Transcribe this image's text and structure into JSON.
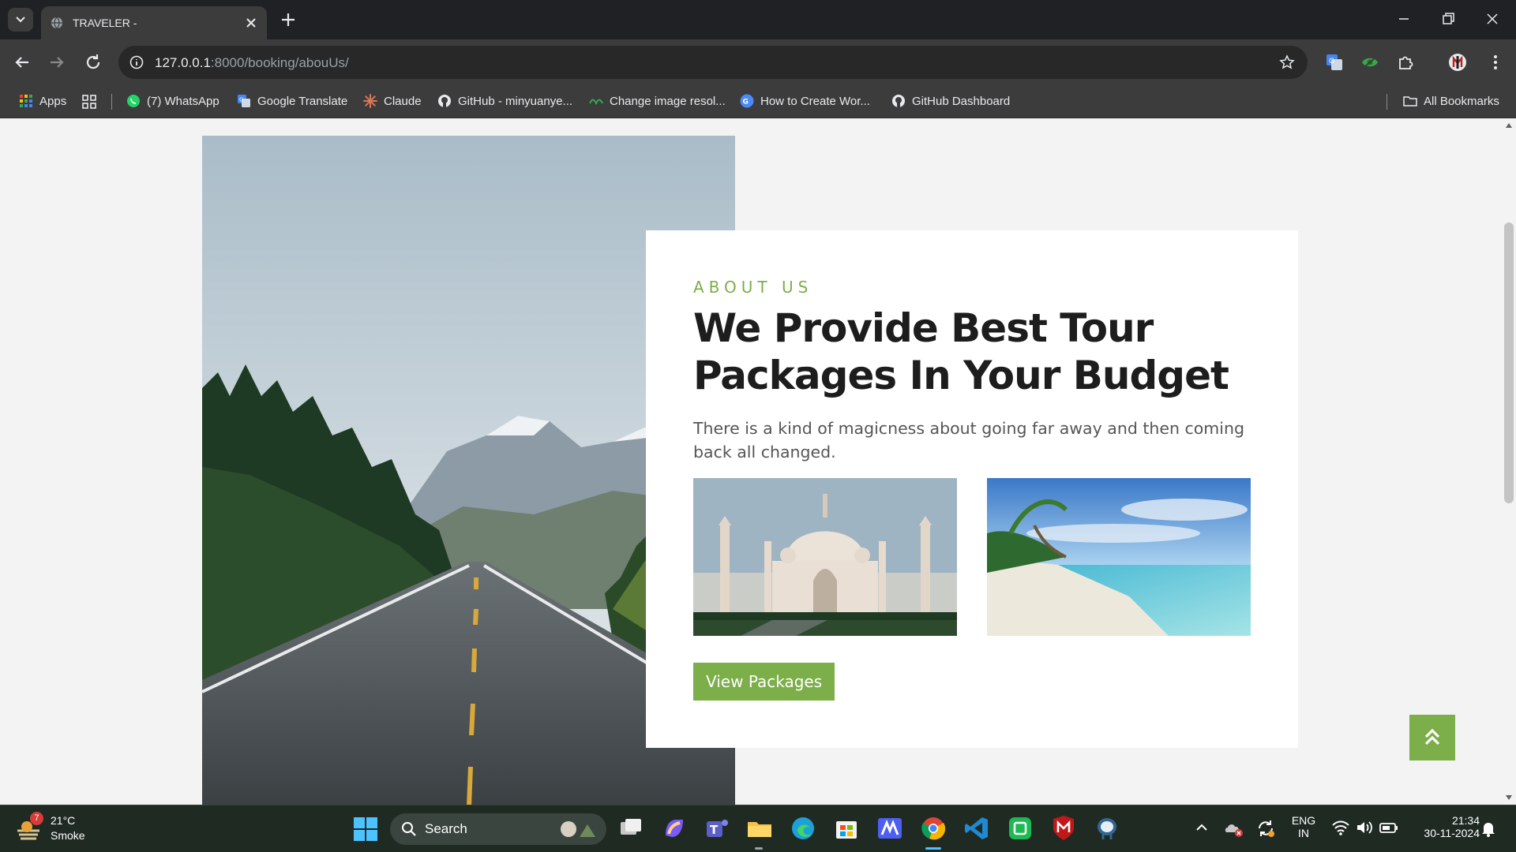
{
  "browser": {
    "tab_title": "TRAVELER -",
    "url_host": "127.0.0.1",
    "url_path": ":8000/booking/abouUs/"
  },
  "bookmarks": [
    {
      "label": "Apps",
      "icon": "apps-grid-icon"
    },
    {
      "label": "(7) WhatsApp",
      "icon": "whatsapp-icon"
    },
    {
      "label": "Google Translate",
      "icon": "google-translate-icon"
    },
    {
      "label": "Claude",
      "icon": "claude-icon"
    },
    {
      "label": "GitHub - minyuanye...",
      "icon": "github-icon"
    },
    {
      "label": "Change image resol...",
      "icon": "change-image-icon"
    },
    {
      "label": "How to Create Wor...",
      "icon": "howto-icon"
    },
    {
      "label": "GitHub Dashboard",
      "icon": "github-icon"
    }
  ],
  "all_bookmarks_label": "All Bookmarks",
  "page": {
    "eyebrow": "ABOUT US",
    "heading": "We Provide Best Tour Packages In Your Budget",
    "description": "There is a kind of magicness about going far away and then coming back all changed.",
    "cta_label": "View Packages",
    "accent_color": "#7cae49"
  },
  "taskbar": {
    "weather_badge": "7",
    "temperature": "21°C",
    "condition": "Smoke",
    "search_label": "Search",
    "lang_line1": "ENG",
    "lang_line2": "IN",
    "time": "21:34",
    "date": "30-11-2024"
  }
}
